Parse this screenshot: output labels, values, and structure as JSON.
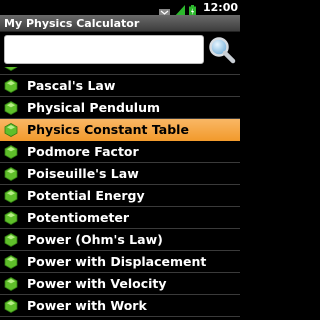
{
  "status_bar": {
    "time": "12:00",
    "icons": [
      "wifi-icon",
      "signal-icon",
      "battery-icon"
    ]
  },
  "app": {
    "title": "My Physics Calculator"
  },
  "search": {
    "value": "",
    "placeholder": "",
    "button_icon": "magnifier-icon"
  },
  "list": {
    "selected_label": "Physics Constant Table",
    "items": [
      {
        "label": "Pascal's Law"
      },
      {
        "label": "Physical Pendulum"
      },
      {
        "label": "Physics Constant Table"
      },
      {
        "label": "Podmore Factor"
      },
      {
        "label": "Poiseuille's Law"
      },
      {
        "label": "Potential Energy"
      },
      {
        "label": "Potentiometer"
      },
      {
        "label": "Power (Ohm's Law)"
      },
      {
        "label": "Power with Displacement"
      },
      {
        "label": "Power with Velocity"
      },
      {
        "label": "Power with Work"
      }
    ]
  },
  "colors": {
    "accent_selected": "#f29b2e",
    "icon_green": "#5fbf2a",
    "title_bar": "#4f4f4f"
  }
}
